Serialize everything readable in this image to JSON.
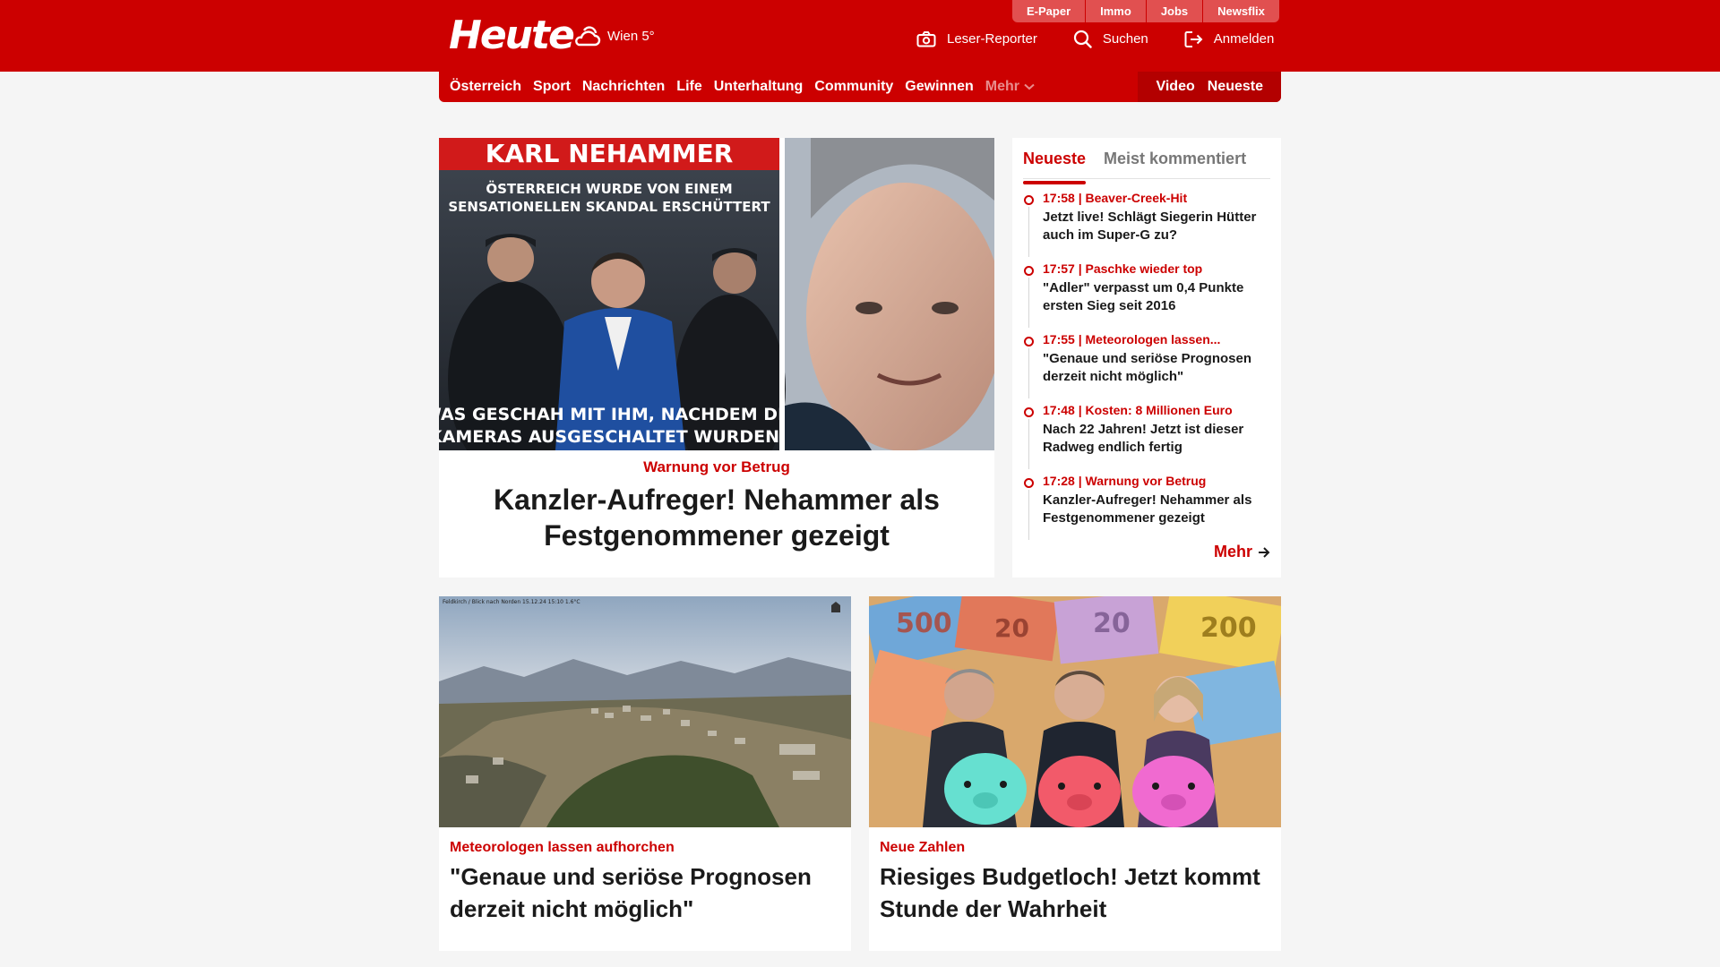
{
  "brand": {
    "logo": "Heute",
    "color": "#cc0000"
  },
  "weather": {
    "location": "Wien 5°",
    "icon": "cloud-sun-icon"
  },
  "topnav": [
    "E-Paper",
    "Immo",
    "Jobs",
    "Newsflix"
  ],
  "header_actions": {
    "reporter": "Leser-Reporter",
    "search": "Suchen",
    "login": "Anmelden"
  },
  "mainnav": {
    "items": [
      "Österreich",
      "Sport",
      "Nachrichten",
      "Life",
      "Unterhaltung",
      "Community",
      "Gewinnen"
    ],
    "more": "Mehr",
    "video": "Video",
    "newest": "Neueste"
  },
  "hero": {
    "image_text": {
      "banner": "KARL NEHAMMER",
      "top": "ÖSTERREICH WURDE VON EINEM SENSATIONELLEN SKANDAL ERSCHÜTTERT",
      "bottom": "WAS GESCHAH MIT IHM, NACHDEM DIE KAMERAS AUSGESCHALTET WURDEN?"
    },
    "kicker": "Warnung vor Betrug",
    "title": "Kanzler-Aufreger! Nehammer als Festgenommener gezeigt"
  },
  "sidebar": {
    "tabs": [
      "Neueste",
      "Meist kommentiert"
    ],
    "items": [
      {
        "meta": "17:58 | Beaver-Creek-Hit",
        "title": "Jetzt live! Schlägt Siegerin Hütter auch im Super-G zu?"
      },
      {
        "meta": "17:57 | Paschke wieder top",
        "title": "\"Adler\" verpasst um 0,4 Punkte ersten Sieg seit 2016"
      },
      {
        "meta": "17:55 | Meteorologen lassen...",
        "title": "\"Genaue und seriöse Prognosen derzeit nicht möglich\""
      },
      {
        "meta": "17:48 | Kosten: 8 Millionen Euro",
        "title": "Nach 22 Jahren! Jetzt ist dieser Radweg endlich fertig"
      },
      {
        "meta": "17:28 | Warnung vor Betrug",
        "title": "Kanzler-Aufreger! Nehammer als Festgenommener gezeigt"
      }
    ],
    "more": "Mehr"
  },
  "cards": [
    {
      "kicker": "Meteorologen lassen aufhorchen",
      "title": "\"Genaue und seriöse Prognosen derzeit nicht möglich\"",
      "image_caption": "Feldkirch / Blick nach Norden 15.12.24 15:10 1.6°C"
    },
    {
      "kicker": "Neue Zahlen",
      "title": "Riesiges Budgetloch! Jetzt kommt Stunde der Wahrheit"
    }
  ]
}
